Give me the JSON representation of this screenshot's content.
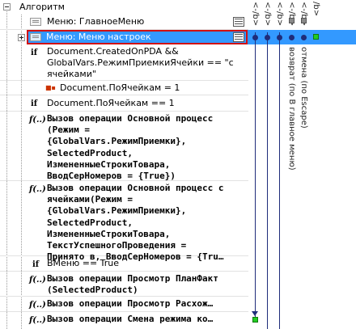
{
  "tree": {
    "root_label": "Алгоритм",
    "rows": [
      {
        "icon": "menu",
        "text": "Меню: ГлавноеМеню"
      },
      {
        "icon": "menu",
        "text": "Меню: Меню настроек",
        "selected": true
      },
      {
        "icon": "if",
        "text": "Document.CreatedOnPDA &&\nGlobalVars.РежимПриемкиЯчейки == \"с\nячейками\""
      },
      {
        "icon": "assign",
        "text": "Document.ПоЯчейкам = 1"
      },
      {
        "icon": "if",
        "text": "Document.ПоЯчейкам == 1"
      },
      {
        "icon": "func",
        "text": "Вызов операции Основной процесс\n(Режим =\n{GlobalVars.РежимПриемки},\nSelectedProduct,\nИзмененныеСтрокиТовара,\nВводСерНомеров = {True})"
      },
      {
        "icon": "func",
        "text": "Вызов операции Основной процесс с\nячейками(Режим =\n{GlobalVars.РежимПриемки},\nSelectedProduct,\nИзмененныеСтрокиТовара,\nТекстУспешногоПроведения =\nПринято в, ВводСерНомеров = {Tru…"
      },
      {
        "icon": "if",
        "text": "ВМеню == True"
      },
      {
        "icon": "func",
        "text": "Вызов операции Просмотр ПланФакт\n(SelectedProduct)"
      },
      {
        "icon": "func",
        "text": "Вызов операции Просмотр Расхож…"
      },
      {
        "icon": "func",
        "text": "Вызов операции Смена режима ко…"
      }
    ],
    "icon_labels": {
      "if": "if",
      "func": "f(..)"
    }
  },
  "columns": {
    "headers": [
      "<-/b>",
      "<-/b>",
      "<-/b>",
      "<-/b>",
      "<-/b>",
      "/b>"
    ],
    "vertical_labels": [
      "возврат (по В главное меню)",
      "отмена (по Escape)"
    ]
  },
  "colors": {
    "selection": "#3399ff",
    "column_line": "#1f2c7a",
    "highlight_box": "#d11010",
    "marker_green": "#22cc22"
  }
}
